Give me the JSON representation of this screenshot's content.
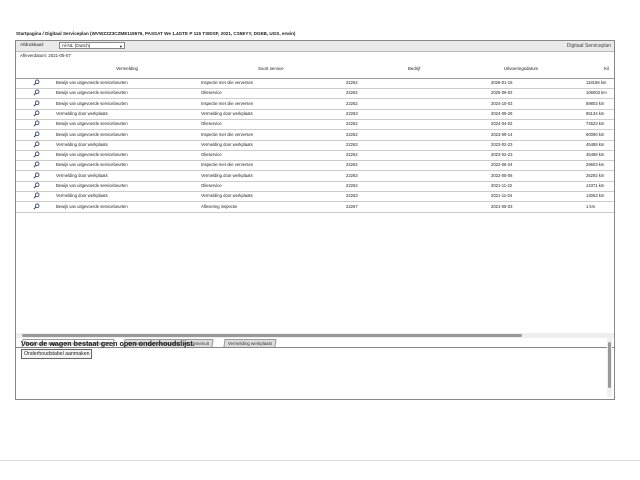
{
  "breadcrumb": "Startpagina / Digitaal Serviceplan (WVWZZZ3CZME119576, PASSAT We 1.4GTE P 115 TSIDSF, 2021, CS5EYY, DGEB, UGS, erwin)",
  "toolbar": {
    "print_label": "Afdrukkaal:",
    "language_value": "nl-NL (Dutch)",
    "app_title": "Digitaal Serviceplan"
  },
  "date_line": "Afleverdatum: 2021-05-07",
  "table": {
    "headers": [
      "Vermelding",
      "Soort service",
      "Bedrijf",
      "Uitvoeringsdatum",
      "Kil"
    ],
    "rows": [
      [
        "Bewijs van uitgevoerde servicebeurten",
        "Inspectie met olie verversen",
        "22262",
        "2026-01-15",
        "118196 km"
      ],
      [
        "Bewijs van uitgevoerde servicebeurten",
        "Olieservice",
        "22262",
        "2025-09-02",
        "106003 km"
      ],
      [
        "Bewijs van uitgevoerde servicebeurten",
        "Inspectie met olie verversen",
        "22262",
        "2024-10-03",
        "89803 km"
      ],
      [
        "Vermelding door werkplaats",
        "Vermelding door werkplaats",
        "22263",
        "2024-09-26",
        "85134 km"
      ],
      [
        "Bewijs van uitgevoerde servicebeurten",
        "Olieservice",
        "22262",
        "2024-04-02",
        "74523 km"
      ],
      [
        "Bewijs van uitgevoerde servicebeurten",
        "Inspectie met olie verversen",
        "22262",
        "2023-09-14",
        "60090 km"
      ],
      [
        "Vermelding door werkplaats",
        "Vermelding door werkplaats",
        "22263",
        "2023-02-23",
        "45488 km"
      ],
      [
        "Bewijs van uitgevoerde servicebeurten",
        "Olieservice",
        "22262",
        "2023-02-23",
        "45488 km"
      ],
      [
        "Bewijs van uitgevoerde servicebeurten",
        "Inspectie met olie verversen",
        "22262",
        "2022-06-24",
        "29603 km"
      ],
      [
        "Vermelding door werkplaats",
        "Vermelding door werkplaats",
        "22263",
        "2022-05-06",
        "25292 km"
      ],
      [
        "Bewijs van uitgevoerde servicebeurten",
        "Olieservice",
        "22262",
        "2021-11-22",
        "14371 km"
      ],
      [
        "Vermelding door werkplaats",
        "Vermelding door werkplaats",
        "22263",
        "2021-11-04",
        "13063 km"
      ],
      [
        "Bewijs van uitgevoerde servicebeurten",
        "Aflevering inspectie",
        "22267",
        "2021-05-03",
        "1 km"
      ]
    ]
  },
  "tabs": [
    "Bewijs van uitgevoerde servicebeurten (07)",
    "Garantie tegen doorroesten van binnenuit",
    "Vermelding werkplaats"
  ],
  "notice": "Voor de wagen bestaat geen open onderhoudslijst.",
  "maintenance_button": "Onderhoudstabel aanmaken",
  "icons": {
    "row_action": "magnifier-icon"
  }
}
